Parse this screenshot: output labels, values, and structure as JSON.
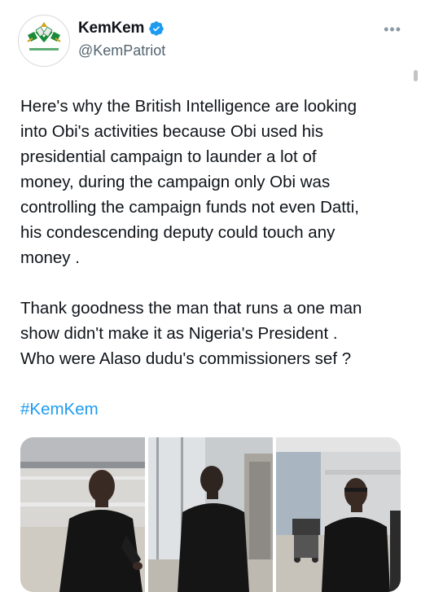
{
  "author": {
    "display_name": "KemKem",
    "handle": "@KemPatriot",
    "verified": true,
    "avatar_icon": "flag-emblem-logo"
  },
  "actions": {
    "more_label": "•••"
  },
  "tweet": {
    "paragraphs": [
      "Here's why the British Intelligence are looking\ninto Obi's activities because Obi used his\npresidential campaign to launder a lot of\nmoney, during the campaign only Obi was\ncontrolling the campaign funds not even Datti,\nhis condescending deputy could touch any\nmoney .",
      "Thank goodness the man that runs a one man\nshow didn't make it as Nigeria's President .\nWho were Alaso dudu's  commissioners sef ?"
    ],
    "hashtag": "#KemKem"
  },
  "media": {
    "photo_count": 3,
    "photos": [
      "airport-photo-1",
      "airport-photo-2",
      "airport-photo-3"
    ]
  },
  "colors": {
    "link": "#1d9bf0",
    "text": "#0f1419",
    "secondary": "#536471",
    "verified": "#1d9bf0"
  }
}
